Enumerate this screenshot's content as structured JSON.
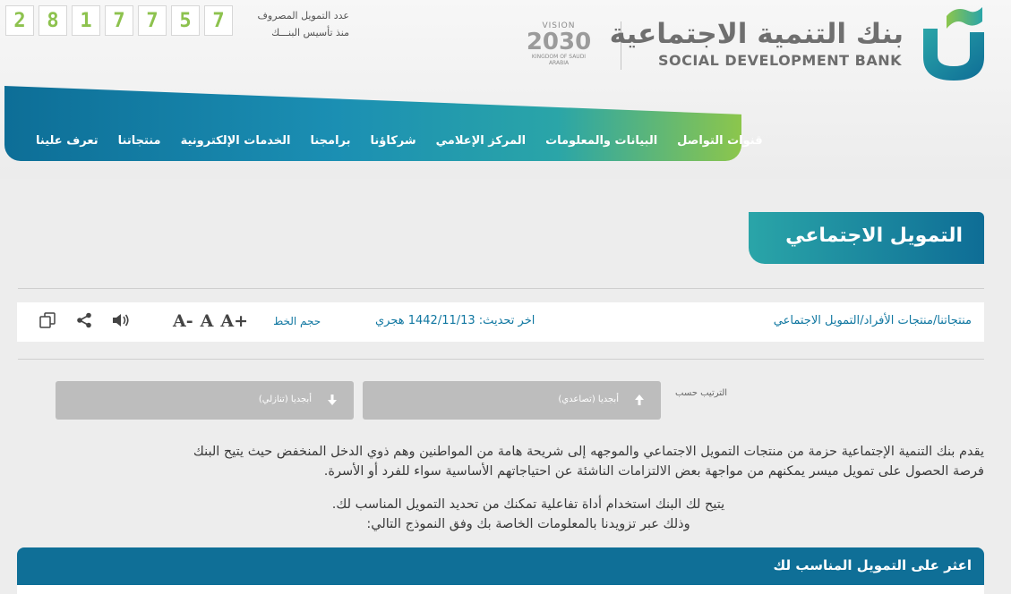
{
  "counter": {
    "digits": [
      "2",
      "8",
      "1",
      "7",
      "7",
      "5",
      "7"
    ],
    "label_top": "عدد التمويل المصروف",
    "label_bottom": "منذ تأسيس البنـــك"
  },
  "vision": {
    "line1": "VISION",
    "line2": "2030",
    "line3": "KINGDOM OF SAUDI ARABIA"
  },
  "bank": {
    "name_ar": "بنك التنمية الاجتماعية",
    "name_en": "SOCIAL DEVELOPMENT BANK"
  },
  "nav": {
    "items": [
      "تعرف علينا",
      "منتجاتنا",
      "الخدمات الإلكترونية",
      "برامجنا",
      "شركاؤنا",
      "المركز الإعلامي",
      "البيانات والمعلومات",
      "قنوات التواصل"
    ]
  },
  "page_title": "التمويل الاجتماعي",
  "toolbar": {
    "crumb_1": "منتجاتنا",
    "crumb_2": "منتجات الأفراد",
    "crumb_3": "التمويل الاجتماعي",
    "sep": "/",
    "updated": "اخر تحديث: 1442/11/13 هجري",
    "font_size_label": "حجم الخط",
    "font_plus": "A+",
    "font_normal": "A",
    "font_minus": "A-"
  },
  "sort": {
    "label": "الترتيب حسب",
    "asc": "أبجديا (تصاعدي)",
    "desc": "أبجديا (تنازلي)"
  },
  "content": {
    "intro_line1": "يقدم بنك التنمية الإجتماعية حزمة من منتجات التمويل الاجتماعي والموجهه إلى شريحة هامة من المواطنين وهم ذوي الدخل المنخفض حيث يتيح البنك",
    "intro_line2": "فرصة الحصول على تمويل ميسر يمكنهم من مواجهة بعض الالتزامات الناشئة عن احتياجاتهم الأساسية سواء للفرد أو الأسرة.",
    "tool_line1": "يتيح لك البنك استخدام أداة تفاعلية تمكنك من تحديد التمويل المناسب لك.",
    "tool_line2": "وذلك عبر تزويدنا بالمعلومات الخاصة بك وفق النموذج التالي:"
  },
  "find_box_title": "اعثر على التمويل المناسب لك",
  "colors": {
    "primary": "#0f6f97",
    "accent": "#2aa5a8",
    "green": "#8cc64c"
  }
}
